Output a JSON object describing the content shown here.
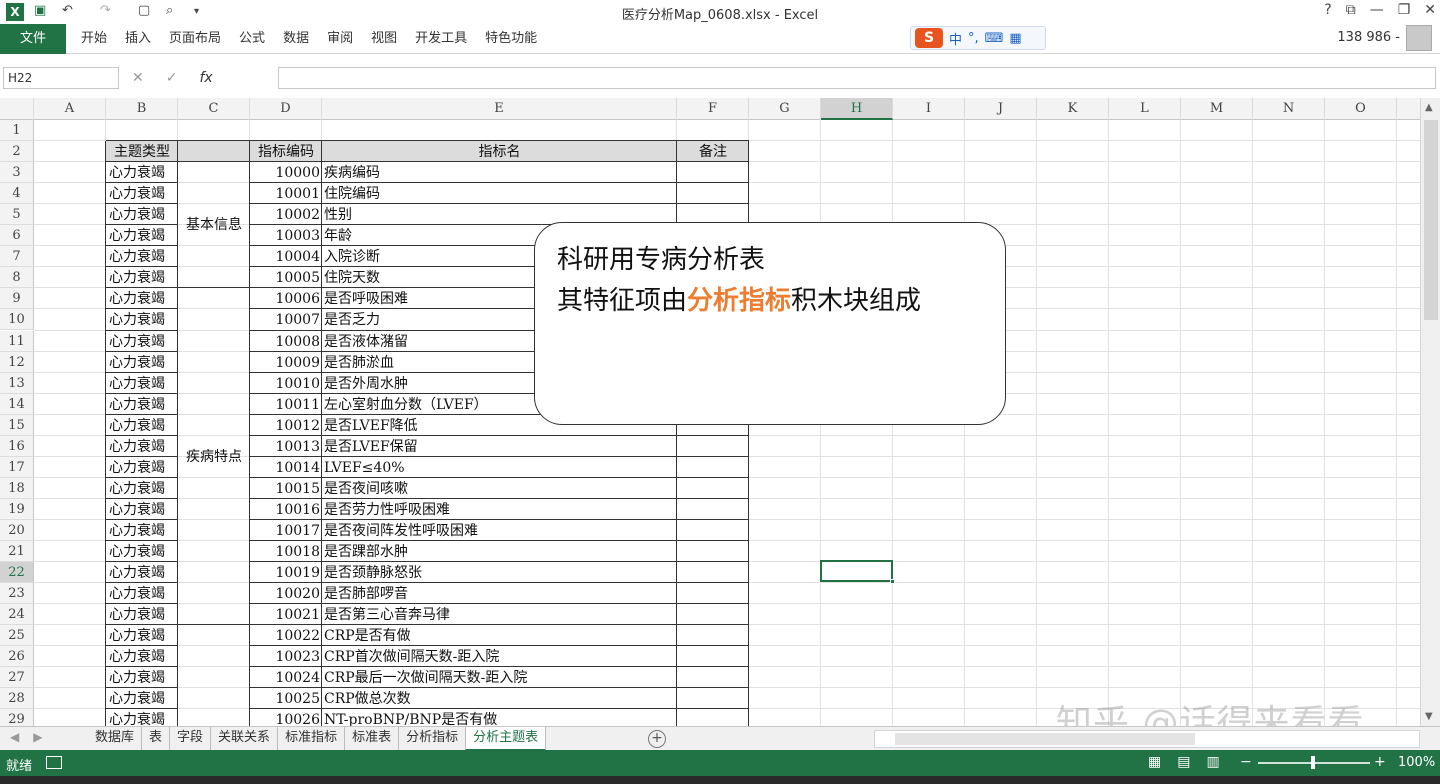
{
  "window": {
    "title": "医疗分析Map_0608.xlsx - Excel",
    "controls": [
      "?",
      "⧉",
      "—",
      "❐",
      "✕"
    ]
  },
  "quick_access": [
    "X",
    "💾",
    "↶",
    "↷",
    "🗋",
    "🔍"
  ],
  "ribbon": {
    "file_tab": "文件",
    "tabs": [
      "开始",
      "插入",
      "页面布局",
      "公式",
      "数据",
      "审阅",
      "视图",
      "开发工具",
      "特色功能"
    ],
    "user_count": "138 986 -"
  },
  "ime": {
    "logo": "S",
    "lang": "中",
    "punct": "°,",
    "keyboard": "⌨",
    "grid": "▦"
  },
  "formula_bar": {
    "name_box": "H22",
    "cancel": "✕",
    "confirm": "✓",
    "fx": "fx",
    "content": ""
  },
  "columns": [
    "A",
    "B",
    "C",
    "D",
    "E",
    "F",
    "G",
    "H",
    "I",
    "J",
    "K",
    "L",
    "M",
    "N",
    "O"
  ],
  "selected_cell": "H22",
  "table": {
    "headers": {
      "topic": "主题类型",
      "indicator_code": "指标编码",
      "indicator_name": "指标名",
      "remark": "备注"
    },
    "groups": [
      {
        "label": "基本信息"
      },
      {
        "label": "疾病特点"
      }
    ],
    "rows": [
      {
        "row": 3,
        "topic": "心力衰竭",
        "code": "10000",
        "name": "疾病编码"
      },
      {
        "row": 4,
        "topic": "心力衰竭",
        "code": "10001",
        "name": "住院编码"
      },
      {
        "row": 5,
        "topic": "心力衰竭",
        "code": "10002",
        "name": "性别"
      },
      {
        "row": 6,
        "topic": "心力衰竭",
        "code": "10003",
        "name": "年龄"
      },
      {
        "row": 7,
        "topic": "心力衰竭",
        "code": "10004",
        "name": "入院诊断"
      },
      {
        "row": 8,
        "topic": "心力衰竭",
        "code": "10005",
        "name": "住院天数"
      },
      {
        "row": 9,
        "topic": "心力衰竭",
        "code": "10006",
        "name": "是否呼吸困难"
      },
      {
        "row": 10,
        "topic": "心力衰竭",
        "code": "10007",
        "name": "是否乏力"
      },
      {
        "row": 11,
        "topic": "心力衰竭",
        "code": "10008",
        "name": "是否液体潴留"
      },
      {
        "row": 12,
        "topic": "心力衰竭",
        "code": "10009",
        "name": "是否肺淤血"
      },
      {
        "row": 13,
        "topic": "心力衰竭",
        "code": "10010",
        "name": "是否外周水肿"
      },
      {
        "row": 14,
        "topic": "心力衰竭",
        "code": "10011",
        "name": "左心室射血分数（LVEF）"
      },
      {
        "row": 15,
        "topic": "心力衰竭",
        "code": "10012",
        "name": "是否LVEF降低"
      },
      {
        "row": 16,
        "topic": "心力衰竭",
        "code": "10013",
        "name": "是否LVEF保留"
      },
      {
        "row": 17,
        "topic": "心力衰竭",
        "code": "10014",
        "name": "LVEF≤40%"
      },
      {
        "row": 18,
        "topic": "心力衰竭",
        "code": "10015",
        "name": "是否夜间咳嗽"
      },
      {
        "row": 19,
        "topic": "心力衰竭",
        "code": "10016",
        "name": "是否劳力性呼吸困难"
      },
      {
        "row": 20,
        "topic": "心力衰竭",
        "code": "10017",
        "name": "是否夜间阵发性呼吸困难"
      },
      {
        "row": 21,
        "topic": "心力衰竭",
        "code": "10018",
        "name": "是否踝部水肿"
      },
      {
        "row": 22,
        "topic": "心力衰竭",
        "code": "10019",
        "name": "是否颈静脉怒张"
      },
      {
        "row": 23,
        "topic": "心力衰竭",
        "code": "10020",
        "name": "是否肺部啰音"
      },
      {
        "row": 24,
        "topic": "心力衰竭",
        "code": "10021",
        "name": "是否第三心音奔马律"
      },
      {
        "row": 25,
        "topic": "心力衰竭",
        "code": "10022",
        "name": "CRP是否有做"
      },
      {
        "row": 26,
        "topic": "心力衰竭",
        "code": "10023",
        "name": "CRP首次做间隔天数-距入院"
      },
      {
        "row": 27,
        "topic": "心力衰竭",
        "code": "10024",
        "name": "CRP最后一次做间隔天数-距入院"
      },
      {
        "row": 28,
        "topic": "心力衰竭",
        "code": "10025",
        "name": "CRP做总次数"
      },
      {
        "row": 29,
        "topic": "心力衰竭",
        "code": "10026",
        "name": "NT-proBNP/BNP是否有做"
      }
    ]
  },
  "callout": {
    "line1": "科研用专病分析表",
    "line2_prefix": "其特征项由",
    "line2_highlight": "分析指标",
    "line2_suffix": "积木块组成",
    "highlight_color": "#ed7d31"
  },
  "sheet_tabs": [
    "数据库",
    "表",
    "字段",
    "关联关系",
    "标准指标",
    "标准表",
    "分析指标",
    "分析主题表"
  ],
  "active_sheet": "分析主题表",
  "status": {
    "ready": "就绪",
    "zoom": "100%",
    "minus": "−",
    "plus": "+"
  },
  "watermark": "知乎 @话得来看看",
  "colors": {
    "excel_green": "#217346",
    "accent_orange": "#ed7d31"
  }
}
